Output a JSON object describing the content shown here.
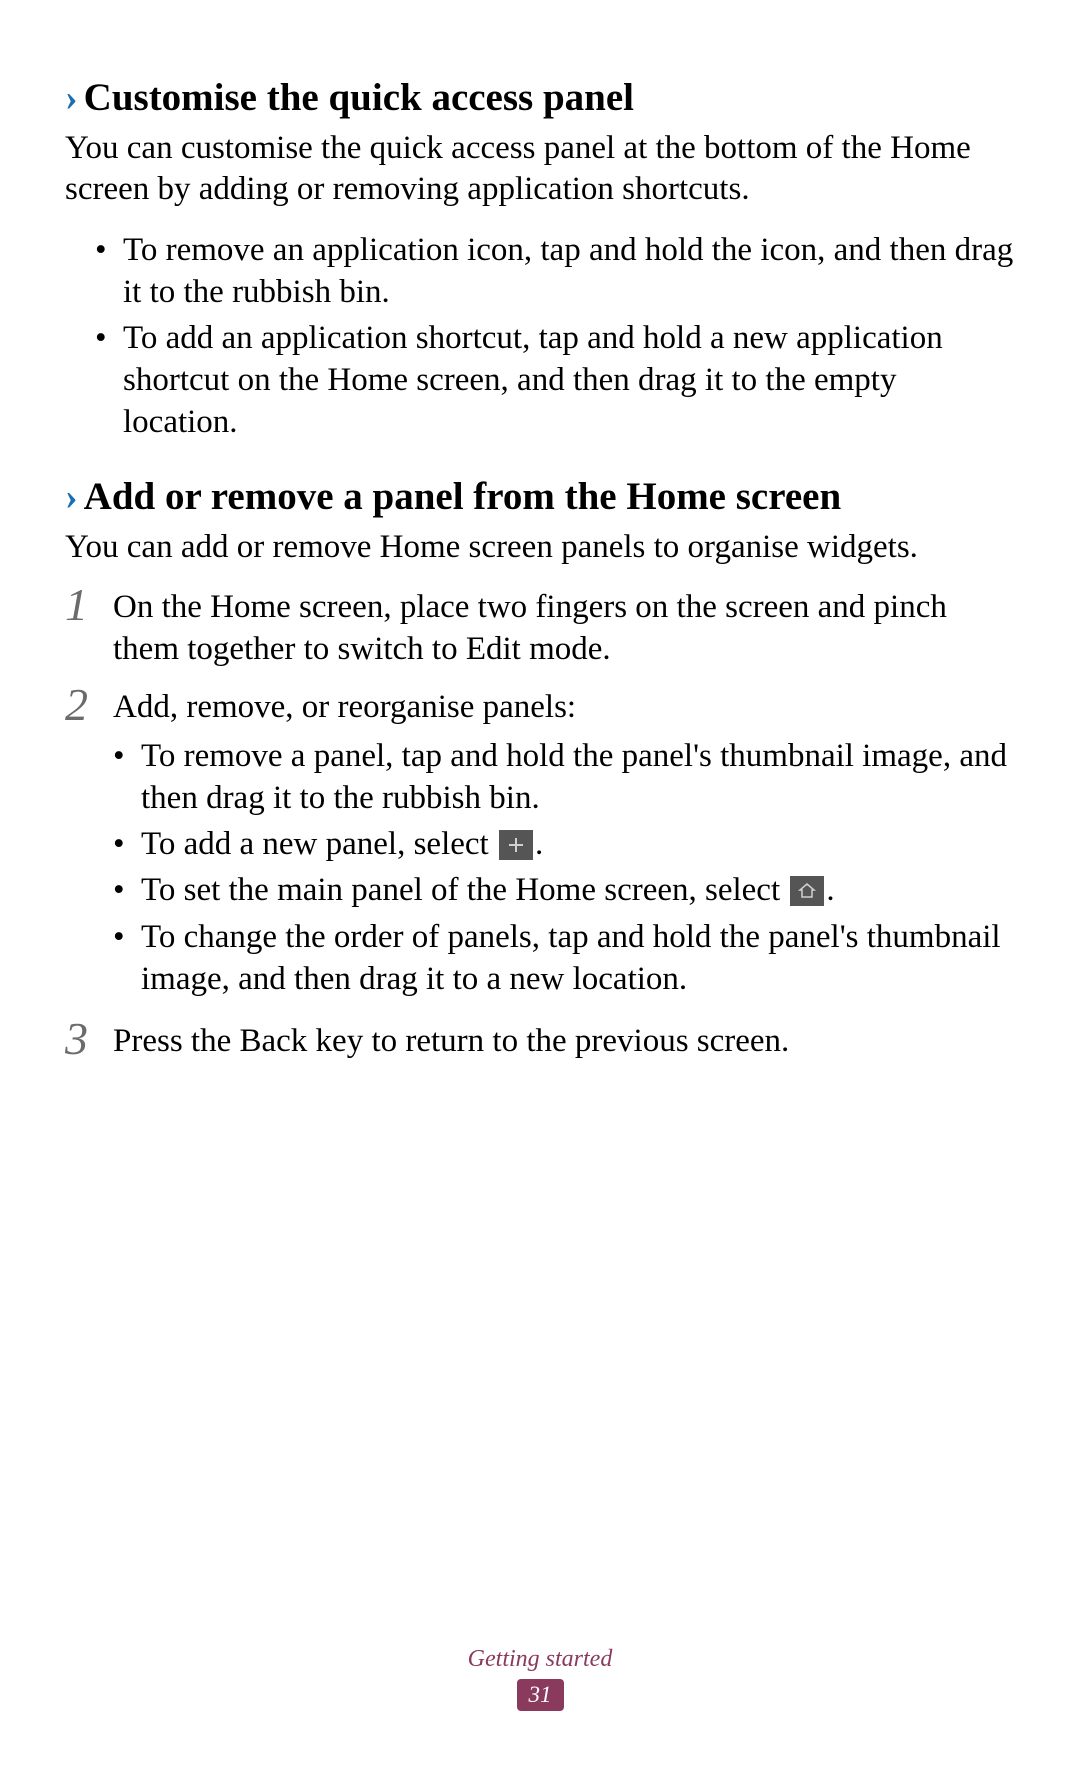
{
  "section1": {
    "heading": "Customise the quick access panel",
    "intro": "You can customise the quick access panel at the bottom of the Home screen by adding or removing application shortcuts.",
    "bullets": [
      "To remove an application icon, tap and hold the icon, and then drag it to the rubbish bin.",
      "To add an application shortcut, tap and hold a new application shortcut on the Home screen, and then drag it to the empty location."
    ]
  },
  "section2": {
    "heading": "Add or remove a panel from the Home screen",
    "intro": "You can add or remove Home screen panels to organise widgets.",
    "steps": [
      {
        "number": "1",
        "text": "On the Home screen, place two fingers on the screen and pinch them together to switch to Edit mode."
      },
      {
        "number": "2",
        "text": "Add, remove, or reorganise panels:",
        "subBullets": {
          "b1": "To remove a panel, tap and hold the panel's thumbnail image, and then drag it to the rubbish bin.",
          "b2_pre": "To add a new panel, select ",
          "b2_post": ".",
          "b3_pre": "To set the main panel of the Home screen, select ",
          "b3_post": ".",
          "b4": "To change the order of panels, tap and hold the panel's thumbnail image, and then drag it to a new location."
        }
      },
      {
        "number": "3",
        "text": "Press the Back key to return to the previous screen."
      }
    ]
  },
  "footer": {
    "label": "Getting started",
    "page": "31"
  }
}
